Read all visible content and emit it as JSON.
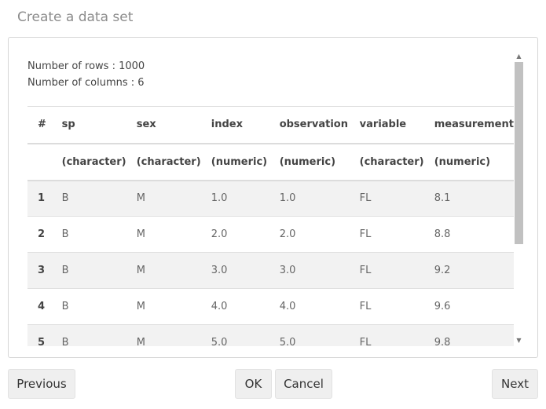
{
  "dialog": {
    "title": "Create a data set"
  },
  "summary": {
    "rows_text": "Number of rows : 1000",
    "cols_text": "Number of columns : 6"
  },
  "table": {
    "headers": [
      "#",
      "sp",
      "sex",
      "index",
      "observation",
      "variable",
      "measurement"
    ],
    "types": [
      "",
      "(character)",
      "(character)",
      "(numeric)",
      "(numeric)",
      "(character)",
      "(numeric)"
    ],
    "rows": [
      [
        "1",
        "B",
        "M",
        "1.0",
        "1.0",
        "FL",
        "8.1"
      ],
      [
        "2",
        "B",
        "M",
        "2.0",
        "2.0",
        "FL",
        "8.8"
      ],
      [
        "3",
        "B",
        "M",
        "3.0",
        "3.0",
        "FL",
        "9.2"
      ],
      [
        "4",
        "B",
        "M",
        "4.0",
        "4.0",
        "FL",
        "9.6"
      ],
      [
        "5",
        "B",
        "M",
        "5.0",
        "5.0",
        "FL",
        "9.8"
      ]
    ]
  },
  "scrollbar": {
    "up_icon": "triangle-up",
    "down_icon": "triangle-down"
  },
  "buttons": {
    "previous": "Previous",
    "ok": "OK",
    "cancel": "Cancel",
    "next": "Next"
  }
}
